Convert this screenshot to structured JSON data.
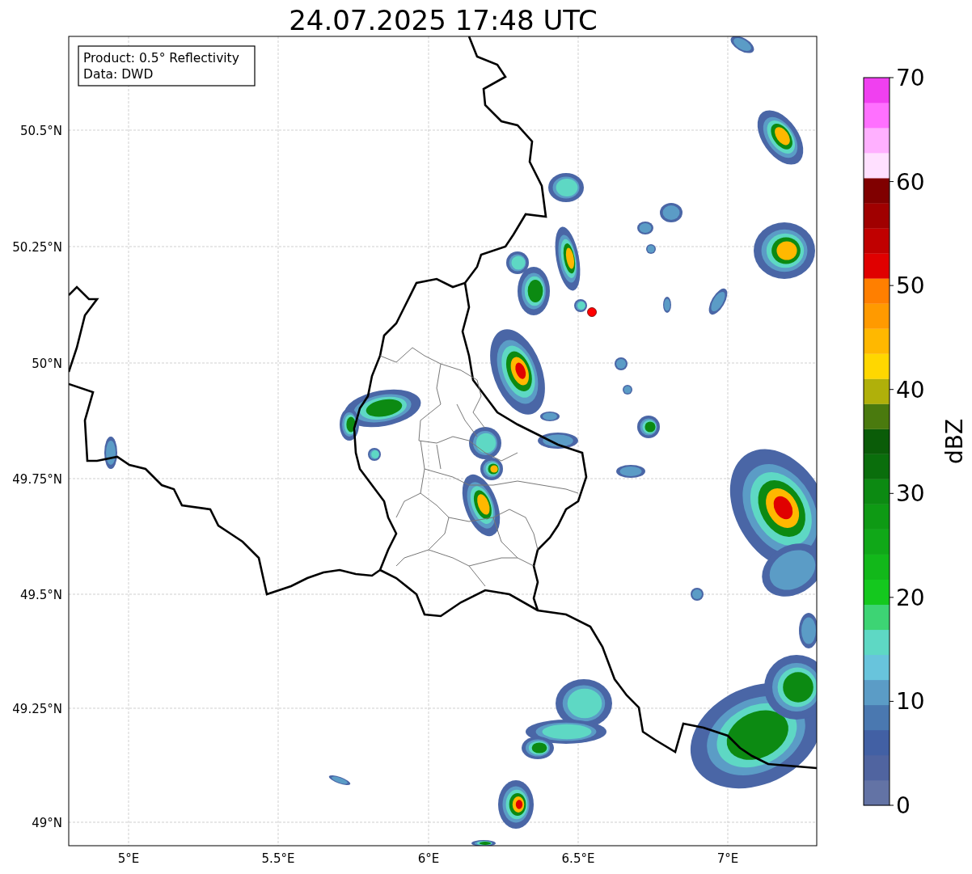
{
  "title": "24.07.2025 17:48 UTC",
  "info_box": {
    "lines": [
      "Product: 0.5° Reflectivity",
      "Data: DWD"
    ]
  },
  "map": {
    "lat_labels": [
      "50.5°N",
      "50.25°N",
      "50°N",
      "49.75°N",
      "49.5°N",
      "49.25°N",
      "49°N"
    ],
    "lon_labels": [
      "5°E",
      "5.5°E",
      "6°E",
      "6.5°E",
      "7°E"
    ]
  },
  "colorbar": {
    "label": "dBZ",
    "ticks": [
      "70",
      "60",
      "50",
      "40",
      "30",
      "20",
      "10",
      "0"
    ],
    "bands": [
      {
        "color": "#6373a5"
      },
      {
        "color": "#5064a0"
      },
      {
        "color": "#4260a4"
      },
      {
        "color": "#4a78b0"
      },
      {
        "color": "#5b9cc6"
      },
      {
        "color": "#68c4dc"
      },
      {
        "color": "#5ed8c4"
      },
      {
        "color": "#3dd474"
      },
      {
        "color": "#14c81e"
      },
      {
        "color": "#12b81a"
      },
      {
        "color": "#10a818"
      },
      {
        "color": "#0e9a14"
      },
      {
        "color": "#0c8a12"
      },
      {
        "color": "#0a6e0c"
      },
      {
        "color": "#0a5c08"
      },
      {
        "color": "#4a7a0e"
      },
      {
        "color": "#b0b00a"
      },
      {
        "color": "#ffd700"
      },
      {
        "color": "#ffb800"
      },
      {
        "color": "#ff9a00"
      },
      {
        "color": "#ff7f00"
      },
      {
        "color": "#e00000"
      },
      {
        "color": "#c00000"
      },
      {
        "color": "#a00000"
      },
      {
        "color": "#800000"
      },
      {
        "color": "#ffe0ff"
      },
      {
        "color": "#ffb0ff"
      },
      {
        "color": "#ff70ff"
      },
      {
        "color": "#f040f0"
      }
    ]
  }
}
